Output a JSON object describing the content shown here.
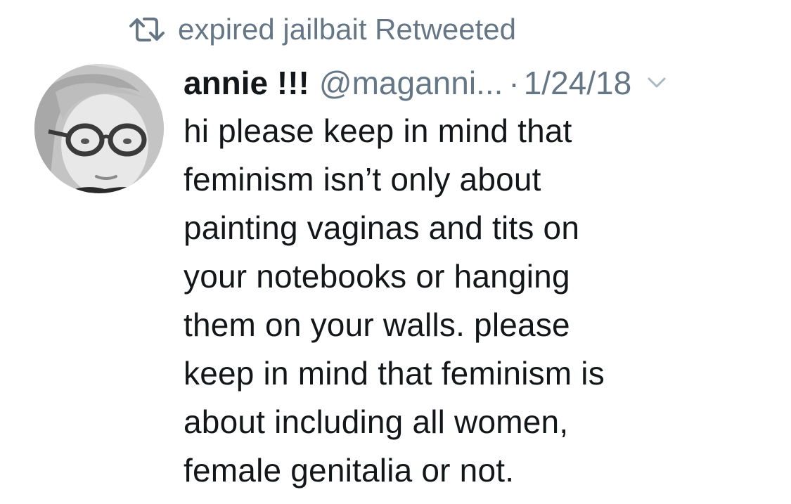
{
  "retweet_context": {
    "icon": "retweet-icon",
    "text": "expired jailbait Retweeted"
  },
  "tweet": {
    "avatar": "user-avatar",
    "display_name": "annie !!!",
    "handle": "@maganni...",
    "separator": "·",
    "date": "1/24/18",
    "menu_icon": "chevron-down-icon",
    "lines": [
      "hi please keep in mind that",
      "feminism isn’t only about",
      "painting vaginas and tits on",
      "your notebooks or hanging",
      "them on your walls. please",
      "keep in mind that feminism is",
      "about including all women,",
      "female genitalia or not."
    ]
  },
  "colors": {
    "text_primary": "#14171a",
    "text_secondary": "#657786",
    "background": "#ffffff"
  }
}
